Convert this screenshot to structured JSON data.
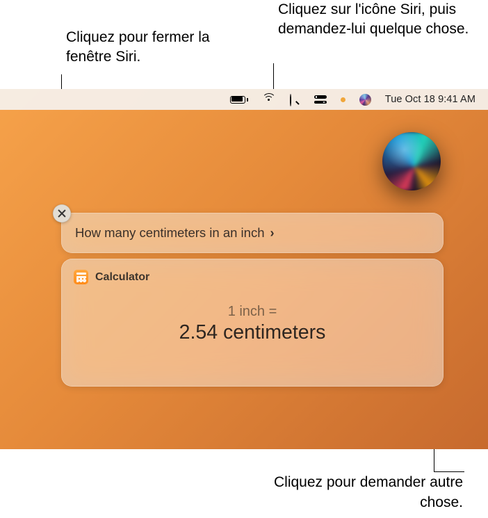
{
  "callouts": {
    "close_window": "Cliquez pour fermer la fenêtre Siri.",
    "siri_icon": "Cliquez sur l'icône Siri, puis demandez-lui quelque chose.",
    "ask_more": "Cliquez pour demander autre chose."
  },
  "menubar": {
    "datetime": "Tue Oct 18  9:41 AM"
  },
  "siri": {
    "query": "How many centimeters in an inch",
    "calculator_label": "Calculator",
    "answer_subtitle": "1 inch =",
    "answer_main": "2.54 centimeters"
  }
}
